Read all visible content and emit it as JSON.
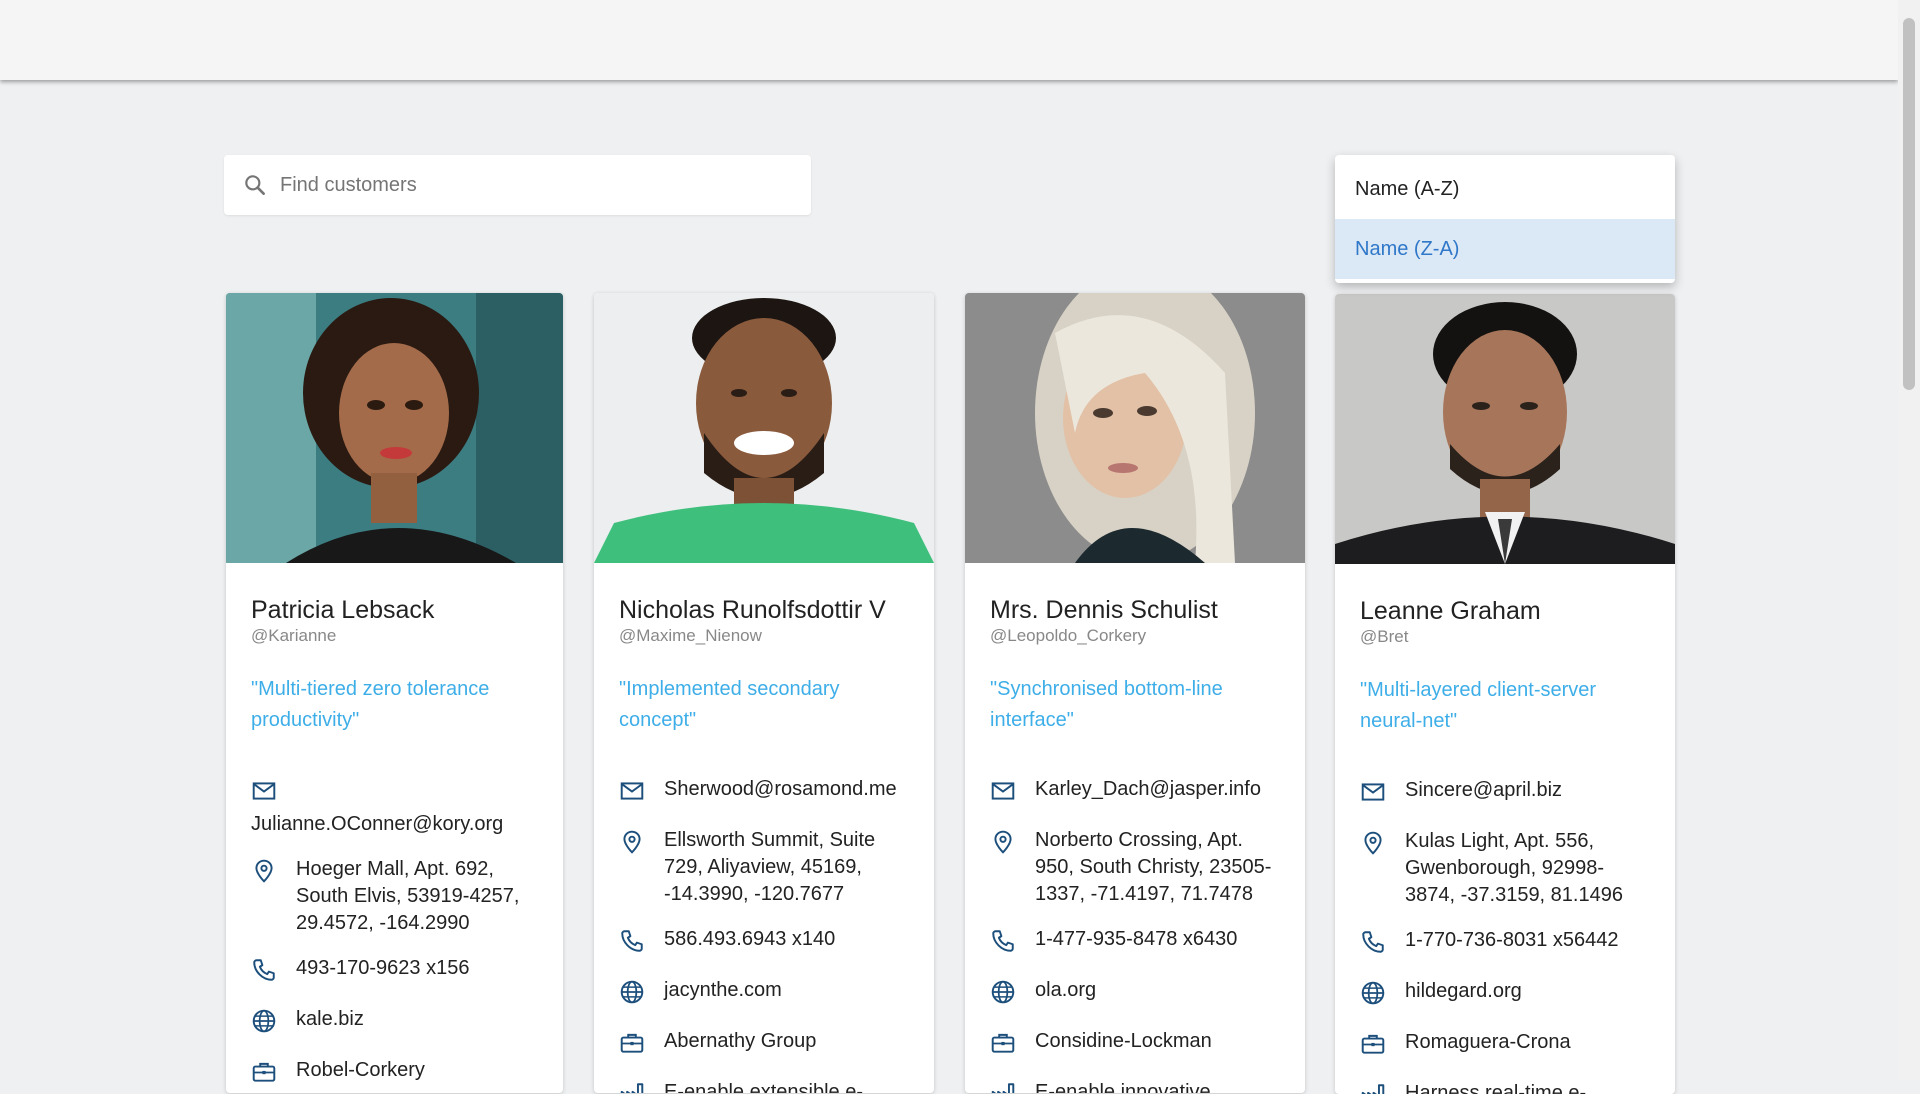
{
  "search": {
    "placeholder": "Find customers",
    "value": ""
  },
  "sort": {
    "options": [
      {
        "label": "Name (A-Z)",
        "selected": false
      },
      {
        "label": "Name (Z-A)",
        "selected": true
      }
    ]
  },
  "colors": {
    "accent": "#3eaee8",
    "icon": "#1d4f7c",
    "selected_bg": "#dbe8f6",
    "selected_text": "#2f77c8"
  },
  "customers": [
    {
      "name": "Patricia Lebsack",
      "username": "@Karianne",
      "catchphrase": "\"Multi-tiered zero tolerance productivity\"",
      "email": "Julianne.OConner@kory.org",
      "address": "Hoeger Mall, Apt. 692, South Elvis, 53919-4257, 29.4572, -164.2990",
      "phone": "493-170-9623 x156",
      "website": "kale.biz",
      "company": "Robel-Corkery",
      "bs": "",
      "photo_icon": "portrait-photo"
    },
    {
      "name": "Nicholas Runolfsdottir V",
      "username": "@Maxime_Nienow",
      "catchphrase": "\"Implemented secondary concept\"",
      "email": "Sherwood@rosamond.me",
      "address": "Ellsworth Summit, Suite 729, Aliyaview, 45169, -14.3990, -120.7677",
      "phone": "586.493.6943 x140",
      "website": "jacynthe.com",
      "company": "Abernathy Group",
      "bs": "E-enable extensible e-",
      "photo_icon": "portrait-photo"
    },
    {
      "name": "Mrs. Dennis Schulist",
      "username": "@Leopoldo_Corkery",
      "catchphrase": "\"Synchronised bottom-line interface\"",
      "email": "Karley_Dach@jasper.info",
      "address": "Norberto Crossing, Apt. 950, South Christy, 23505-1337, -71.4197, 71.7478",
      "phone": "1-477-935-8478 x6430",
      "website": "ola.org",
      "company": "Considine-Lockman",
      "bs": "E-enable innovative",
      "photo_icon": "portrait-photo"
    },
    {
      "name": "Leanne Graham",
      "username": "@Bret",
      "catchphrase": "\"Multi-layered client-server neural-net\"",
      "email": "Sincere@april.biz",
      "address": "Kulas Light, Apt. 556, Gwenborough, 92998-3874, -37.3159, 81.1496",
      "phone": "1-770-736-8031 x56442",
      "website": "hildegard.org",
      "company": "Romaguera-Crona",
      "bs": "Harness real-time e-",
      "photo_icon": "portrait-photo"
    }
  ]
}
